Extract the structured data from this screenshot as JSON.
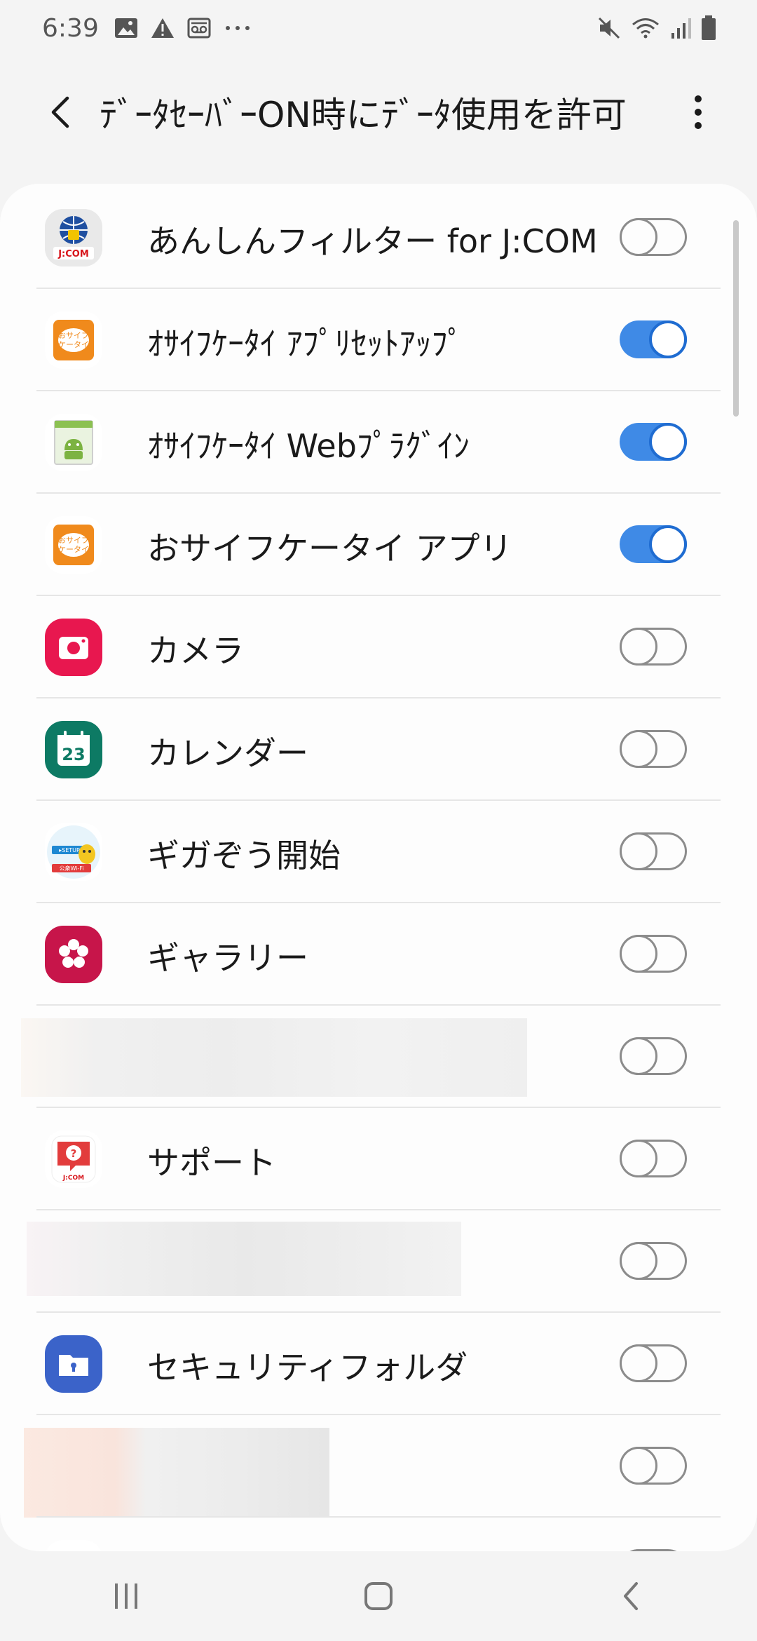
{
  "status_bar": {
    "time": "6:39",
    "left_icons": [
      "image-icon",
      "alert-icon",
      "voicemail-icon",
      "more-dots-icon"
    ],
    "right_icons": [
      "mute-icon",
      "wifi-icon",
      "signal-icon",
      "battery-icon"
    ]
  },
  "app_bar": {
    "title": "ﾃﾞｰﾀｾｰﾊﾞｰON時にﾃﾞｰﾀ使用を許可",
    "back_icon": "back-arrow-icon",
    "more_icon": "more-vertical-icon"
  },
  "apps": [
    {
      "label": "あんしんフィルター for J:COM",
      "enabled": false,
      "icon": "jcom-filter-icon",
      "hidden": false
    },
    {
      "label": "ｵｻｲﾌｹｰﾀｲ ｱﾌﾟﾘｾｯﾄｱｯﾌﾟ",
      "enabled": true,
      "icon": "osaifu-icon",
      "hidden": false
    },
    {
      "label": "ｵｻｲﾌｹｰﾀｲ Webﾌﾟﾗｸﾞｲﾝ",
      "enabled": true,
      "icon": "android-plugin-icon",
      "hidden": false
    },
    {
      "label": "おサイフケータイ アプリ",
      "enabled": true,
      "icon": "osaifu-icon",
      "hidden": false
    },
    {
      "label": "カメラ",
      "enabled": false,
      "icon": "camera-icon",
      "hidden": false
    },
    {
      "label": "カレンダー",
      "enabled": false,
      "icon": "calendar-icon",
      "hidden": false
    },
    {
      "label": "ギガぞう開始",
      "enabled": false,
      "icon": "gigazou-icon",
      "hidden": false
    },
    {
      "label": "ギャラリー",
      "enabled": false,
      "icon": "gallery-icon",
      "hidden": false
    },
    {
      "label": "",
      "enabled": false,
      "icon": "",
      "hidden": true
    },
    {
      "label": "サポート",
      "enabled": false,
      "icon": "jcom-support-icon",
      "hidden": false
    },
    {
      "label": "",
      "enabled": false,
      "icon": "",
      "hidden": true
    },
    {
      "label": "セキュリティフォルダ",
      "enabled": false,
      "icon": "secure-folder-icon",
      "hidden": false
    },
    {
      "label": "",
      "enabled": false,
      "icon": "",
      "hidden": true
    },
    {
      "label": "",
      "enabled": false,
      "icon": "drive-icon",
      "hidden": false
    }
  ],
  "calendar_day": "23",
  "icon_text": {
    "jcom": "J:COM",
    "osaifu_line1": "おサイフ",
    "osaifu_line2": "ケータイ",
    "setup": "▸SETUP",
    "wifi": "公衆Wi-Fi"
  },
  "nav_bar": {
    "recents_icon": "recents-icon",
    "home_icon": "home-icon",
    "back_icon": "nav-back-icon"
  },
  "colors": {
    "toggle_on": "#3f8ae6",
    "toggle_off_border": "#8c8c8c",
    "camera_red": "#e8174f",
    "calendar_green": "#0d7a64",
    "gallery_red": "#c7154a",
    "secure_folder_blue": "#3b63c9",
    "osaifu_orange": "#f08a1c"
  }
}
